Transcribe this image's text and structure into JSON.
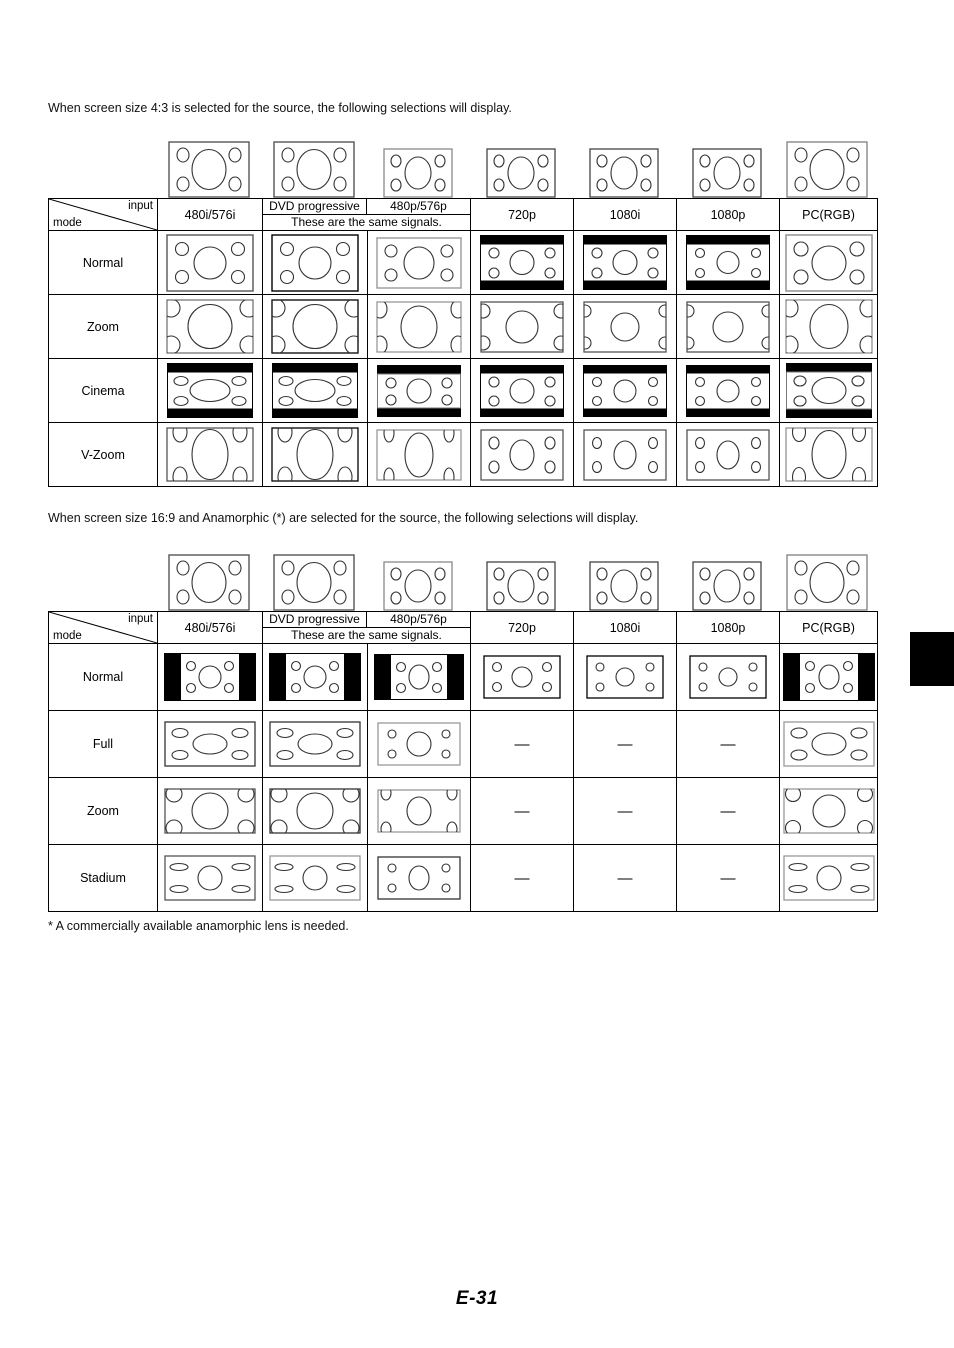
{
  "document": {
    "page_number": "E-31",
    "intro_1": "When screen size 4:3 is selected for the source, the following selections will display.",
    "intro_2": "When screen size 16:9 and Anamorphic (*) are selected for the source, the following selections will display.",
    "footnote": "* A commercially available anamorphic lens is needed."
  },
  "header": {
    "corner_input": "input",
    "corner_mode": "mode",
    "columns": [
      "480i/576i",
      "DVD progressive",
      "480p/576p",
      "720p",
      "1080i",
      "1080p",
      "PC(RGB)"
    ],
    "dvd_progressive": "DVD progressive",
    "p480_576": "480p/576p",
    "same_signals_note": "These are the same signals."
  },
  "table_4_3": {
    "caption": "When screen size 4:3 is selected for the source, the following selections will display.",
    "modes": [
      "Normal",
      "Zoom",
      "Cinema",
      "V-Zoom"
    ],
    "reference_icons": [
      "screen-4-3-ref",
      "screen-4-3-ref",
      "screen-4-3-ref",
      "screen-4-3-ref",
      "screen-4-3-ref",
      "screen-4-3-ref",
      "screen-4-3-ref"
    ],
    "cells": [
      [
        "normal-43",
        "normal-43",
        "normal-43-wide",
        "normal-letterbox",
        "normal-letterbox",
        "normal-letterbox",
        "normal-pc"
      ],
      [
        "zoom-43",
        "zoom-43",
        "zoom-43-wide",
        "zoom-wide",
        "zoom-wide",
        "zoom-wide",
        "zoom-pc"
      ],
      [
        "cinema-43",
        "cinema-43",
        "cinema-43-wide",
        "cinema-wide",
        "cinema-wide",
        "cinema-wide",
        "cinema-pc"
      ],
      [
        "vzoom-43",
        "vzoom-43",
        "vzoom-43-wide",
        "vzoom-wide",
        "vzoom-wide",
        "vzoom-wide",
        "vzoom-pc"
      ]
    ]
  },
  "table_16_9": {
    "caption": "When screen size 16:9 and Anamorphic (*) are selected for the source, the following selections will display.",
    "modes": [
      "Normal",
      "Full",
      "Zoom",
      "Stadium"
    ],
    "reference_icons": [
      "screen-4-3-ref",
      "screen-4-3-ref",
      "screen-4-3-ref",
      "screen-4-3-ref",
      "screen-4-3-ref",
      "screen-4-3-ref",
      "screen-4-3-ref"
    ],
    "unavailable_marker": "—",
    "cells": [
      [
        "normal-pillar",
        "normal-pillar",
        "normal-pillar",
        "plain-wide",
        "plain-wide",
        "plain-wide",
        "normal-pillar"
      ],
      [
        "full-wide",
        "full-wide",
        "full-narrow",
        "—",
        "—",
        "—",
        "full-wide"
      ],
      [
        "zoom169",
        "zoom169",
        "zoom169-narrow",
        "—",
        "—",
        "—",
        "zoom169"
      ],
      [
        "stadium",
        "stadium",
        "stadium-narrow",
        "—",
        "—",
        "—",
        "stadium"
      ]
    ]
  }
}
